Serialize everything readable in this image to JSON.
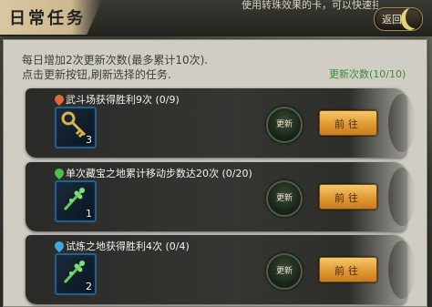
{
  "header": {
    "title": "日常任务",
    "hint": "使用转珠效果的卡，可以快速挂卡",
    "back_label": "返回"
  },
  "info": {
    "line1": "每日增加2次更新次数(最多累计10次).",
    "line2": "点击更新按钮,刷新选择的任务.",
    "refresh_count": "更新次数(10/10)"
  },
  "tasks": [
    {
      "title": "武斗场获得胜利9次 (0/9)",
      "pin_color": "#e0683a",
      "item_icon": "key-icon",
      "item_count": "3",
      "refresh_label": "更新",
      "go_label": "前往"
    },
    {
      "title": "单次藏宝之地累计移动步数达20次 (0/20)",
      "pin_color": "#4cc04a",
      "item_icon": "green-branch-icon",
      "item_count": "1",
      "refresh_label": "更新",
      "go_label": "前往"
    },
    {
      "title": "试炼之地获得胜利4次 (0/4)",
      "pin_color": "#3fa9e0",
      "item_icon": "green-branch-icon",
      "item_count": "2",
      "refresh_label": "更新",
      "go_label": "前往"
    }
  ],
  "colors": {
    "accent_gold": "#e09a32",
    "refresh_count_green": "#3c8a3a",
    "panel_bg": "#cfcdc4"
  }
}
